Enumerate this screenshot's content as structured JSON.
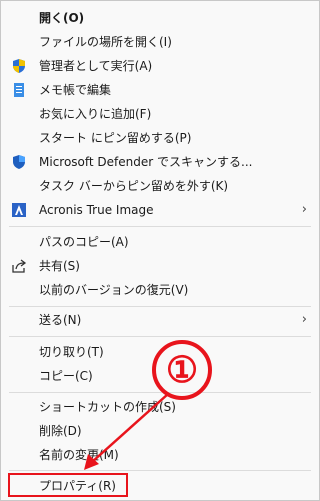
{
  "menu": {
    "items": [
      {
        "label": "開く(O)",
        "icon": ""
      },
      {
        "label": "ファイルの場所を開く(I)",
        "icon": ""
      },
      {
        "label": "管理者として実行(A)",
        "icon": "uac-shield-icon"
      },
      {
        "label": "メモ帳で編集",
        "icon": "notepad-icon"
      },
      {
        "label": "お気に入りに追加(F)",
        "icon": ""
      },
      {
        "label": "スタート にピン留めする(P)",
        "icon": ""
      },
      {
        "label": "Microsoft Defender でスキャンする...",
        "icon": "defender-shield-icon"
      },
      {
        "label": "タスク バーからピン留めを外す(K)",
        "icon": ""
      },
      {
        "label": "Acronis True Image",
        "icon": "acronis-icon",
        "submenu": true
      },
      {
        "label": "パスのコピー(A)",
        "icon": ""
      },
      {
        "label": "共有(S)",
        "icon": "share-icon"
      },
      {
        "label": "以前のバージョンの復元(V)",
        "icon": ""
      },
      {
        "label": "送る(N)",
        "icon": "",
        "submenu": true
      },
      {
        "label": "切り取り(T)",
        "icon": ""
      },
      {
        "label": "コピー(C)",
        "icon": ""
      },
      {
        "label": "ショートカットの作成(S)",
        "icon": ""
      },
      {
        "label": "削除(D)",
        "icon": ""
      },
      {
        "label": "名前の変更(M)",
        "icon": ""
      },
      {
        "label": "プロパティ(R)",
        "icon": ""
      }
    ],
    "submenu_arrow": "›"
  },
  "annotation": {
    "number": "①",
    "color": "#e8141c"
  }
}
